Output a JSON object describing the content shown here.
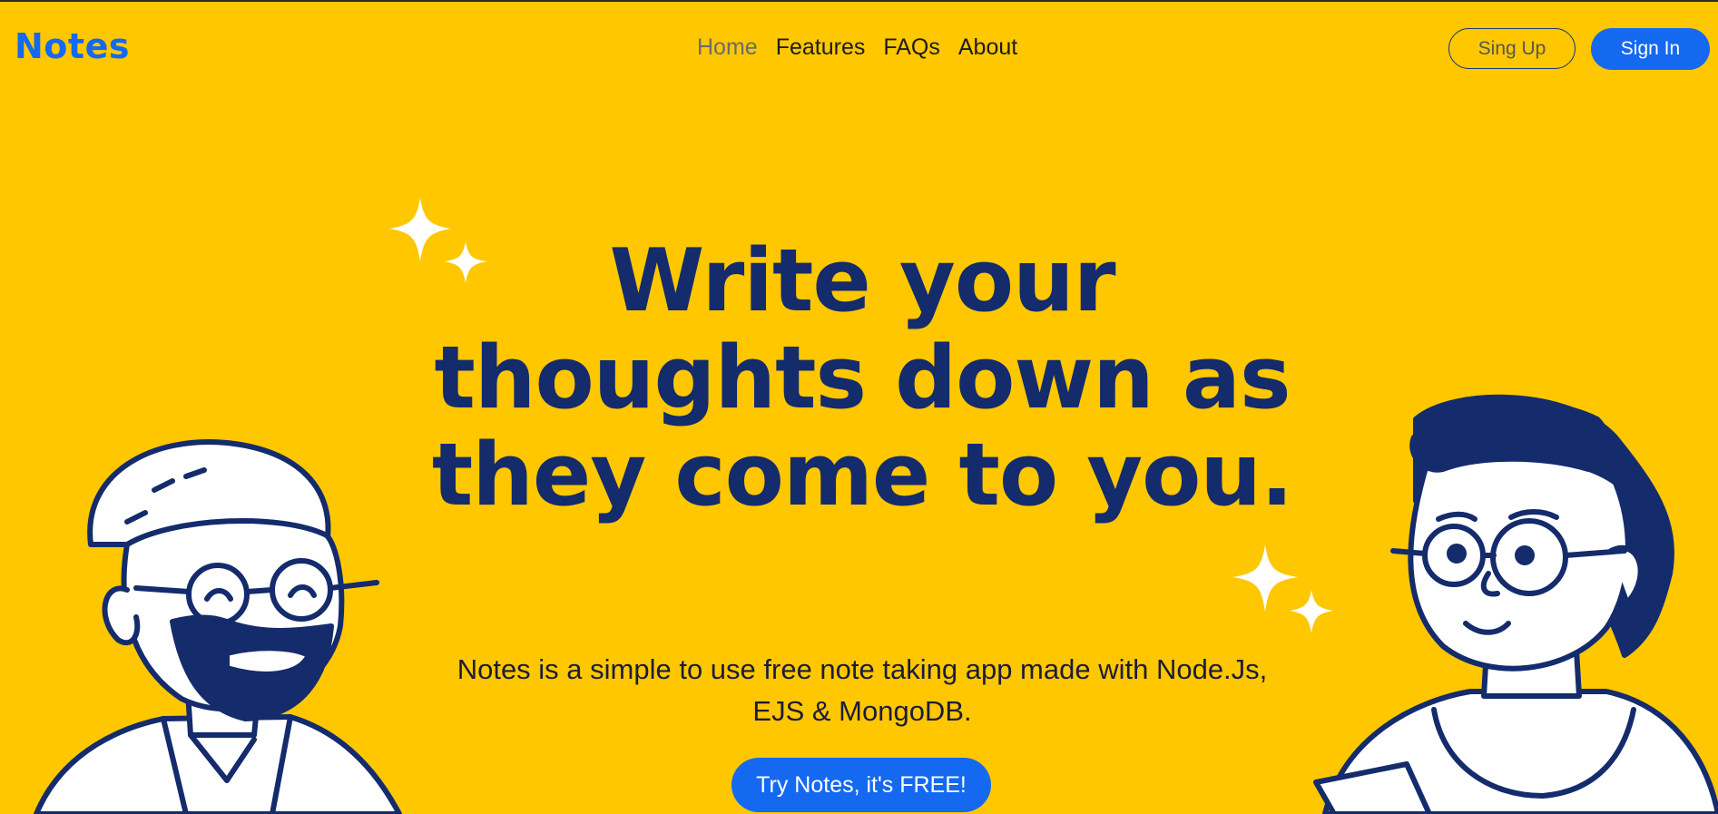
{
  "brand": {
    "logo_text": "Notes"
  },
  "nav": {
    "items": [
      {
        "label": "Home",
        "active": true
      },
      {
        "label": "Features",
        "active": false
      },
      {
        "label": "FAQs",
        "active": false
      },
      {
        "label": "About",
        "active": false
      }
    ]
  },
  "auth": {
    "signup_label": "Sing Up",
    "signin_label": "Sign In"
  },
  "hero": {
    "title": "Write your thoughts down as they come to you.",
    "subtitle": "Notes is a simple to use free note taking app made with Node.Js, EJS & MongoDB.",
    "cta_label": "Try Notes, it's FREE!"
  },
  "colors": {
    "background": "#FFC700",
    "accent": "#1469F0",
    "heading": "#142B6C",
    "illustration_line": "#142B6C",
    "illustration_fill": "#FFFFFF"
  },
  "icons": {
    "sparkle_left": "sparkle-icon",
    "sparkle_right": "sparkle-icon",
    "illustration_left": "bearded-man-illustration",
    "illustration_right": "woman-with-glasses-illustration"
  }
}
